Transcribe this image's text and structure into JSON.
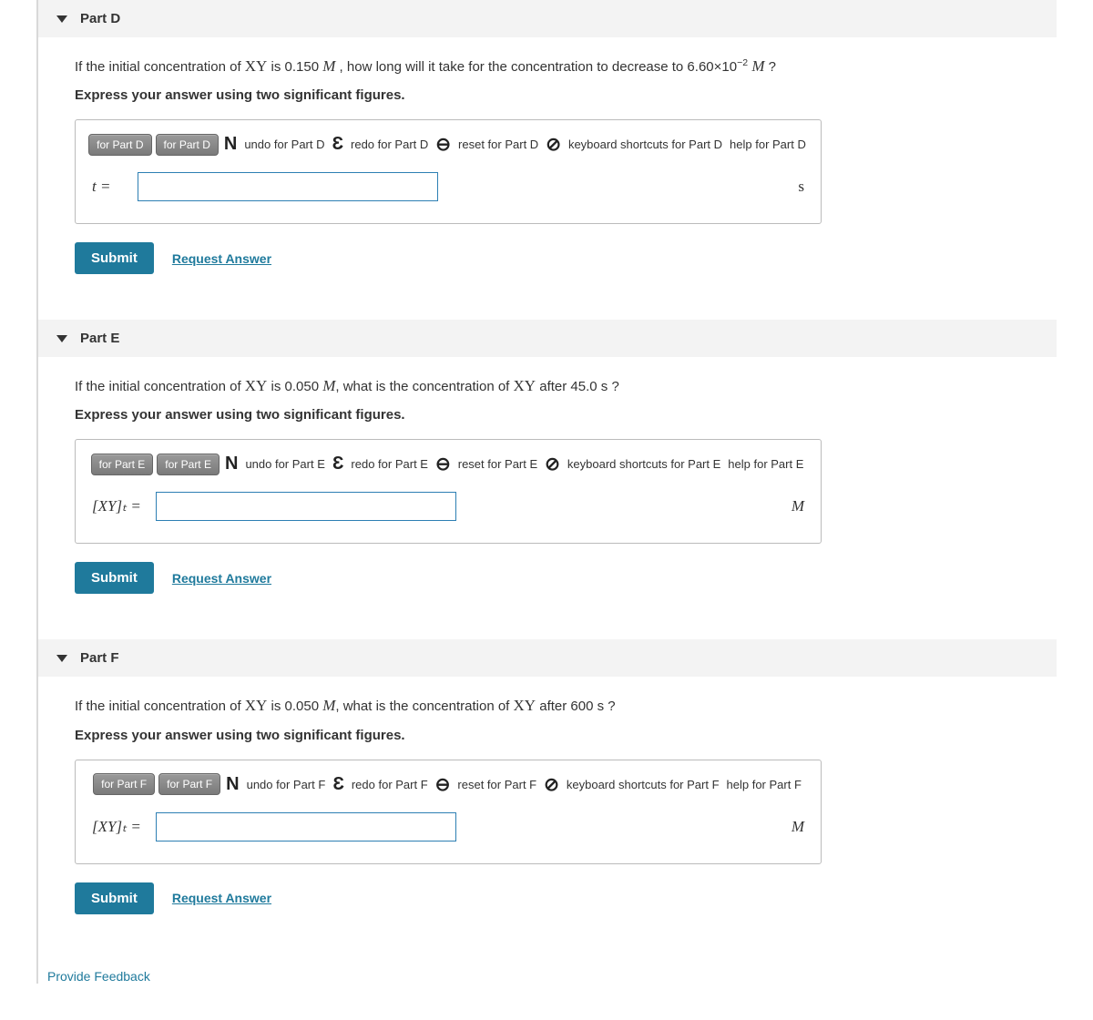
{
  "parts": {
    "D": {
      "title": "Part D",
      "question_prefix": "If the initial concentration of ",
      "question_compound": "XY",
      "question_mid1": " is 0.150 ",
      "question_unit1": "M",
      "question_mid2": " , how long will it take for the concentration to decrease to 6.60×10",
      "question_exp": "−2",
      "question_unit2": " M",
      "question_end": " ?",
      "instruction": "Express your answer using two significant figures.",
      "toolbar": {
        "btn1": "for Part D",
        "btn2": "for Part D",
        "undo": "undo for Part D",
        "redo": "redo for Part D",
        "reset": "reset for Part D",
        "kb": "keyboard shortcuts for Part D",
        "help": "help for Part D"
      },
      "var_label": "t =",
      "unit": "s",
      "submit": "Submit",
      "request": "Request Answer"
    },
    "E": {
      "title": "Part E",
      "question_prefix": "If the initial concentration of ",
      "question_compound": "XY",
      "question_mid1": " is 0.050 ",
      "question_unit1": "M",
      "question_mid2": ", what is the concentration of ",
      "question_compound2": "XY",
      "question_mid3": " after 45.0 s ?",
      "instruction": "Express your answer using two significant figures.",
      "toolbar": {
        "btn1": "for Part E",
        "btn2": "for Part E",
        "undo": "undo for Part E",
        "redo": "redo for Part E",
        "reset": "reset for Part E",
        "kb": "keyboard shortcuts for Part E",
        "help": "help for Part E"
      },
      "var_label": "[XY]ₜ =",
      "unit": "M",
      "submit": "Submit",
      "request": "Request Answer"
    },
    "F": {
      "title": "Part F",
      "question_prefix": "If the initial concentration of ",
      "question_compound": "XY",
      "question_mid1": " is 0.050 ",
      "question_unit1": "M",
      "question_mid2": ", what is the concentration of ",
      "question_compound2": "XY",
      "question_mid3": " after 600 s ?",
      "instruction": "Express your answer using two significant figures.",
      "toolbar": {
        "btn1": "for Part F",
        "btn2": "for Part F",
        "undo": "undo for Part F",
        "redo": "redo for Part F",
        "reset": "reset for Part F",
        "kb": "keyboard shortcuts for Part F",
        "help": "help for Part F"
      },
      "var_label": "[XY]ₜ =",
      "unit": "M",
      "submit": "Submit",
      "request": "Request Answer"
    }
  },
  "footer": "Provide Feedback"
}
